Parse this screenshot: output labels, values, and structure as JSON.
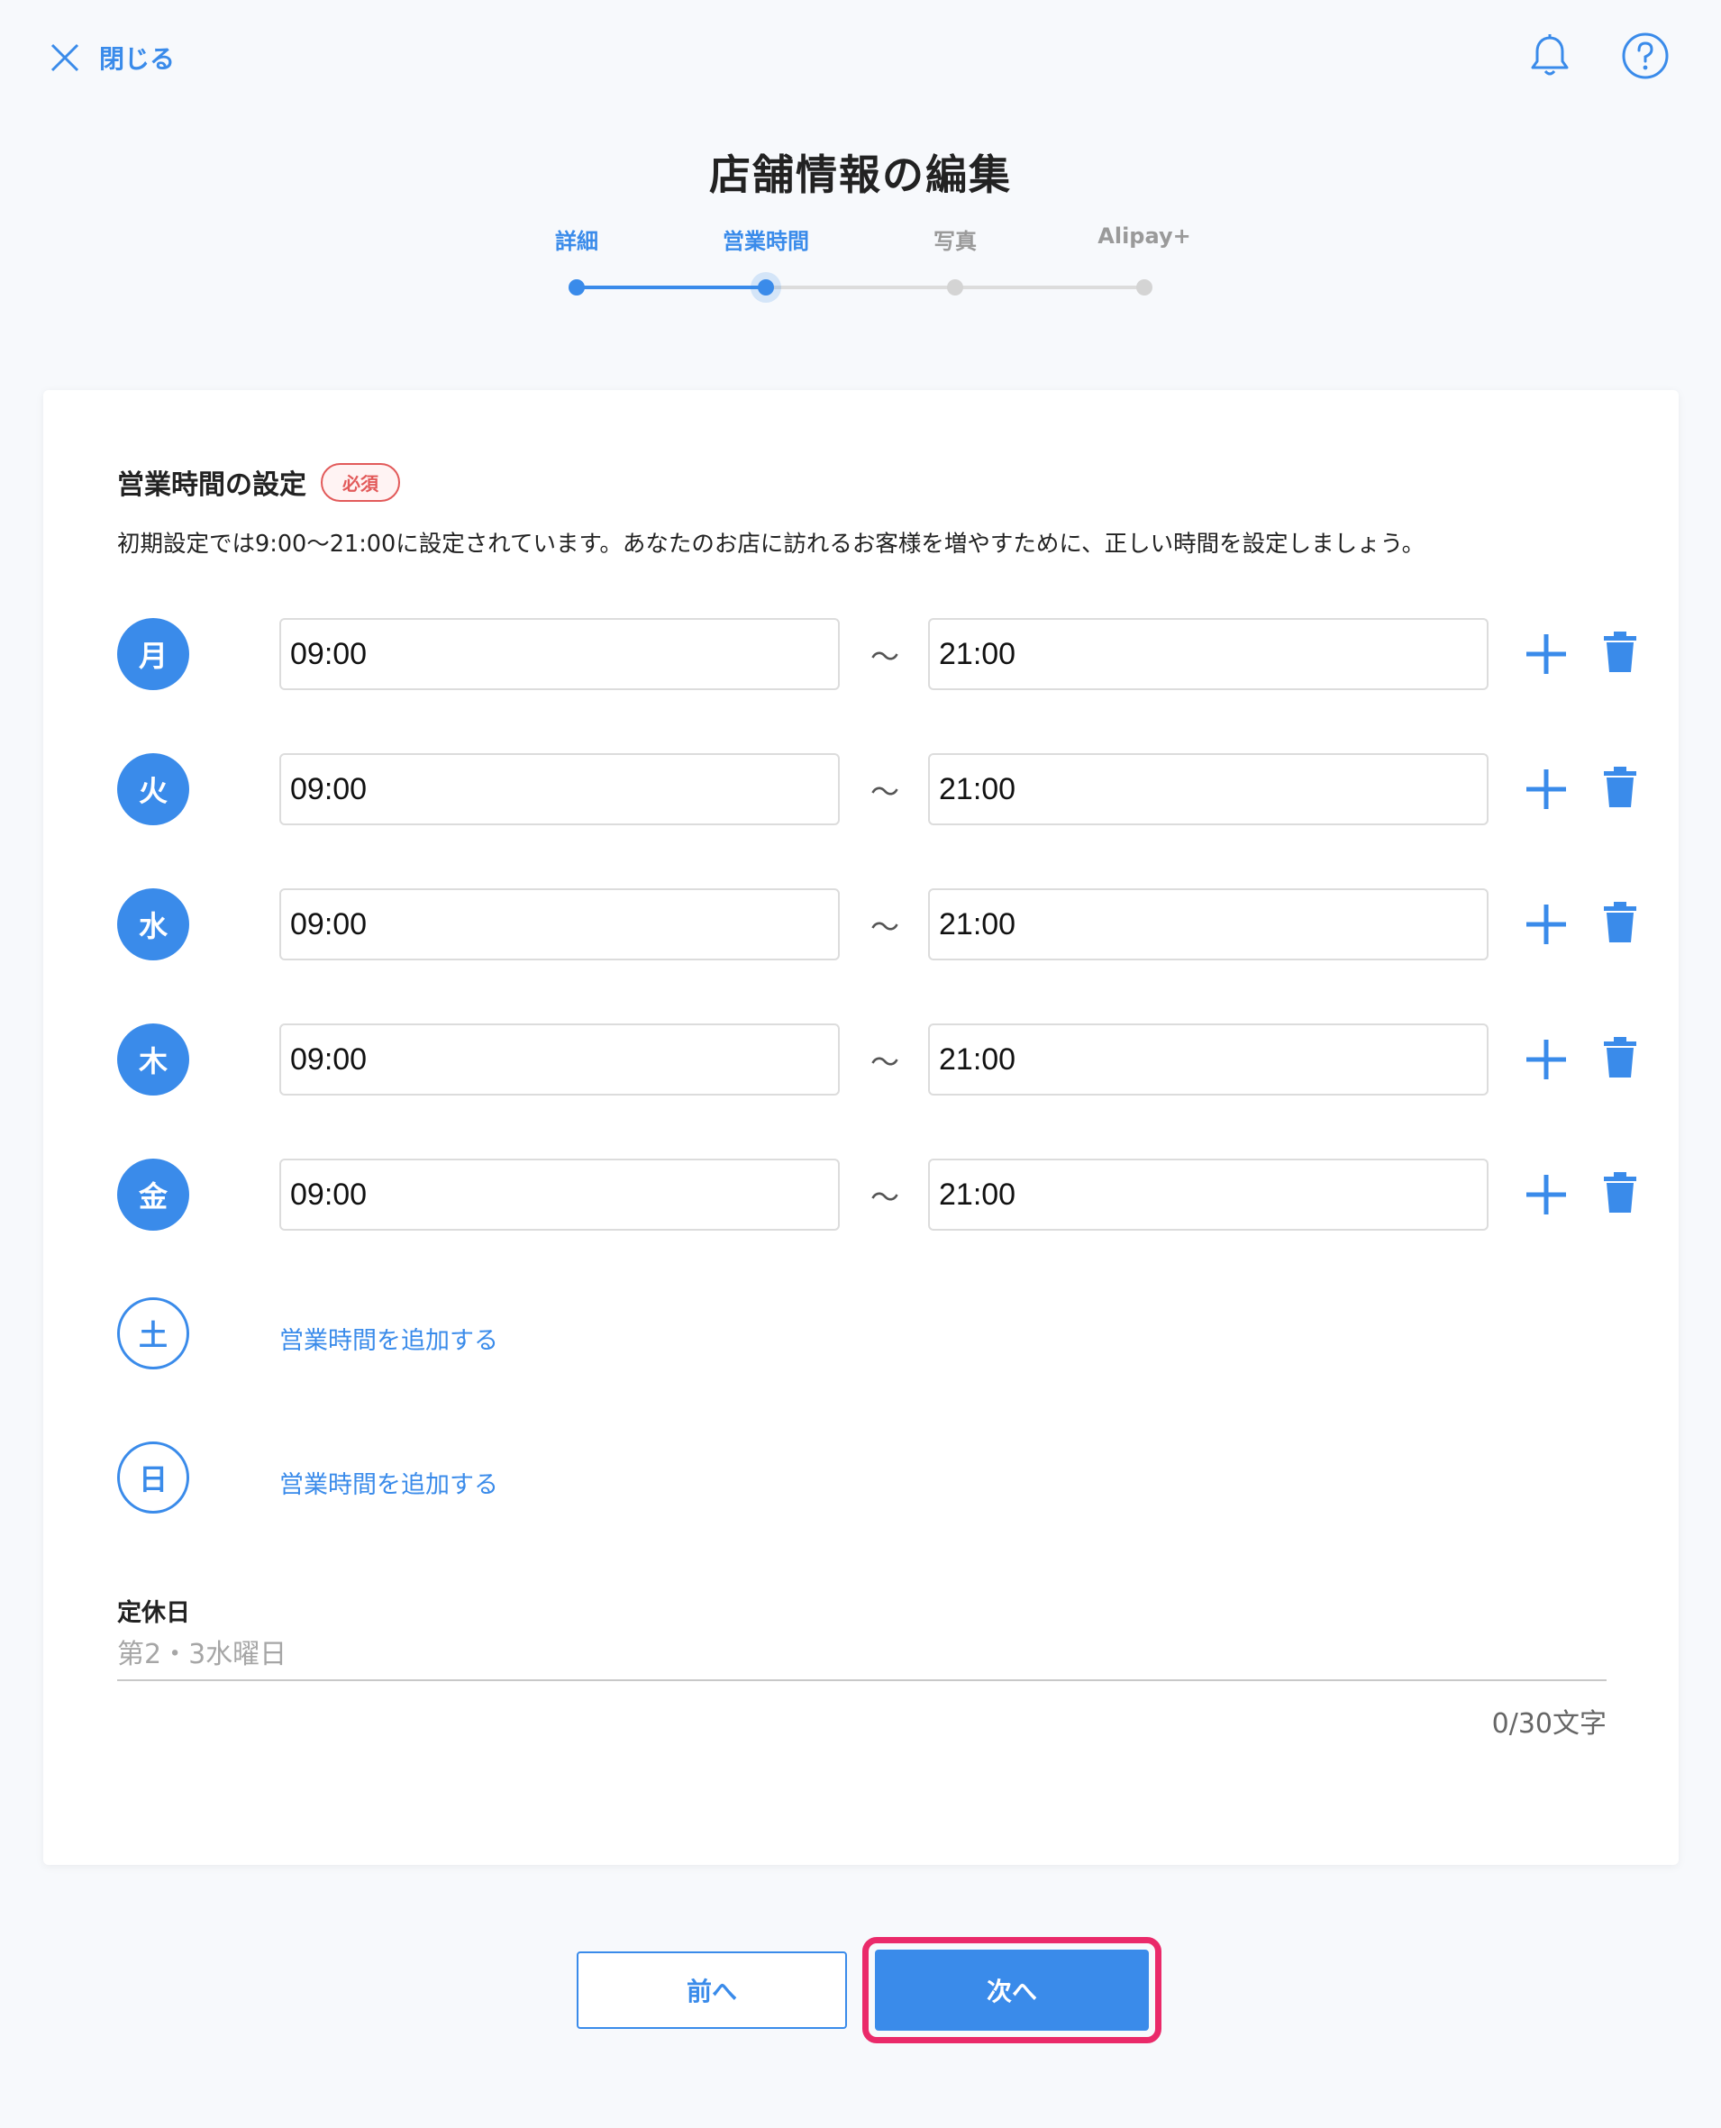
{
  "header": {
    "close_label": "閉じる",
    "title": "店舗情報の編集"
  },
  "stepper": {
    "steps": [
      {
        "label": "詳細",
        "state": "done"
      },
      {
        "label": "営業時間",
        "state": "current"
      },
      {
        "label": "写真",
        "state": "todo"
      },
      {
        "label": "Alipay+",
        "state": "todo"
      }
    ]
  },
  "business_hours": {
    "title": "営業時間の設定",
    "required_badge": "必須",
    "description": "初期設定では9:00〜21:00に設定されています。あなたのお店に訪れるお客様を増やすために、正しい時間を設定しましょう。",
    "separator": "〜",
    "days": [
      {
        "day": "月",
        "from": "09:00",
        "to": "21:00"
      },
      {
        "day": "火",
        "from": "09:00",
        "to": "21:00"
      },
      {
        "day": "水",
        "from": "09:00",
        "to": "21:00"
      },
      {
        "day": "木",
        "from": "09:00",
        "to": "21:00"
      },
      {
        "day": "金",
        "from": "09:00",
        "to": "21:00"
      },
      {
        "day": "土",
        "add_label": "営業時間を追加する"
      },
      {
        "day": "日",
        "add_label": "営業時間を追加する"
      }
    ]
  },
  "holiday": {
    "label": "定休日",
    "placeholder": "第2・3水曜日",
    "value": "",
    "char_count": "0/30文字"
  },
  "footer": {
    "prev_label": "前へ",
    "next_label": "次へ"
  },
  "colors": {
    "accent": "#3a8bea",
    "required": "#e25a5a",
    "highlight": "#ea2a6a"
  }
}
